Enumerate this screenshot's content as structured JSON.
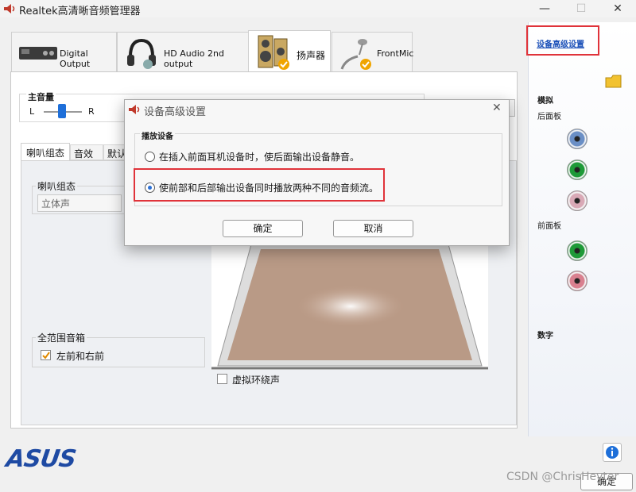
{
  "window": {
    "title": "Realtek高清晰音频管理器",
    "controls": {
      "minimize": "—",
      "maximize": "☐",
      "close": "✕"
    }
  },
  "tabs": [
    {
      "label": "Digital Output",
      "icon": "digital-output-device-icon"
    },
    {
      "label": "HD Audio 2nd output",
      "icon": "headphones-icon"
    },
    {
      "label": "扬声器",
      "icon": "speakers-icon",
      "active": true
    },
    {
      "label": "FrontMic",
      "icon": "microphone-icon"
    }
  ],
  "volume": {
    "label": "主音量",
    "left": "L",
    "right": "R"
  },
  "subtabs": [
    "喇叭组态",
    "音效",
    "默认"
  ],
  "speaker_config": {
    "group_label": "喇叭组态",
    "selected": "立体声"
  },
  "fullrange": {
    "group_label": "全范围音箱",
    "checkbox_label": "左前和右前",
    "checked": true
  },
  "virtual_surround": {
    "label": "虚拟环绕声",
    "checked": false
  },
  "right_panel": {
    "advanced_link": "设备高级设置",
    "analog_label": "模拟",
    "rear_label": "后面板",
    "front_label": "前面板",
    "digital_label": "数字",
    "rear_jacks": [
      "#6a8fc6",
      "#1e9a38",
      "#d9a9b6"
    ],
    "front_jacks": [
      "#1e9a38",
      "#d9808f"
    ]
  },
  "brand": "ASUS",
  "ok_button_partial": "确定",
  "watermark": "CSDN @ChrisHeyter",
  "info_icon": "info-icon",
  "modal": {
    "title": "设备高级设置",
    "section": "播放设备",
    "options": [
      {
        "label": "在插入前面耳机设备时，使后面输出设备静音。",
        "selected": false
      },
      {
        "label": "使前部和后部输出设备同时播放两种不同的音频流。",
        "selected": true
      }
    ],
    "ok": "确定",
    "cancel": "取消",
    "close": "✕"
  }
}
